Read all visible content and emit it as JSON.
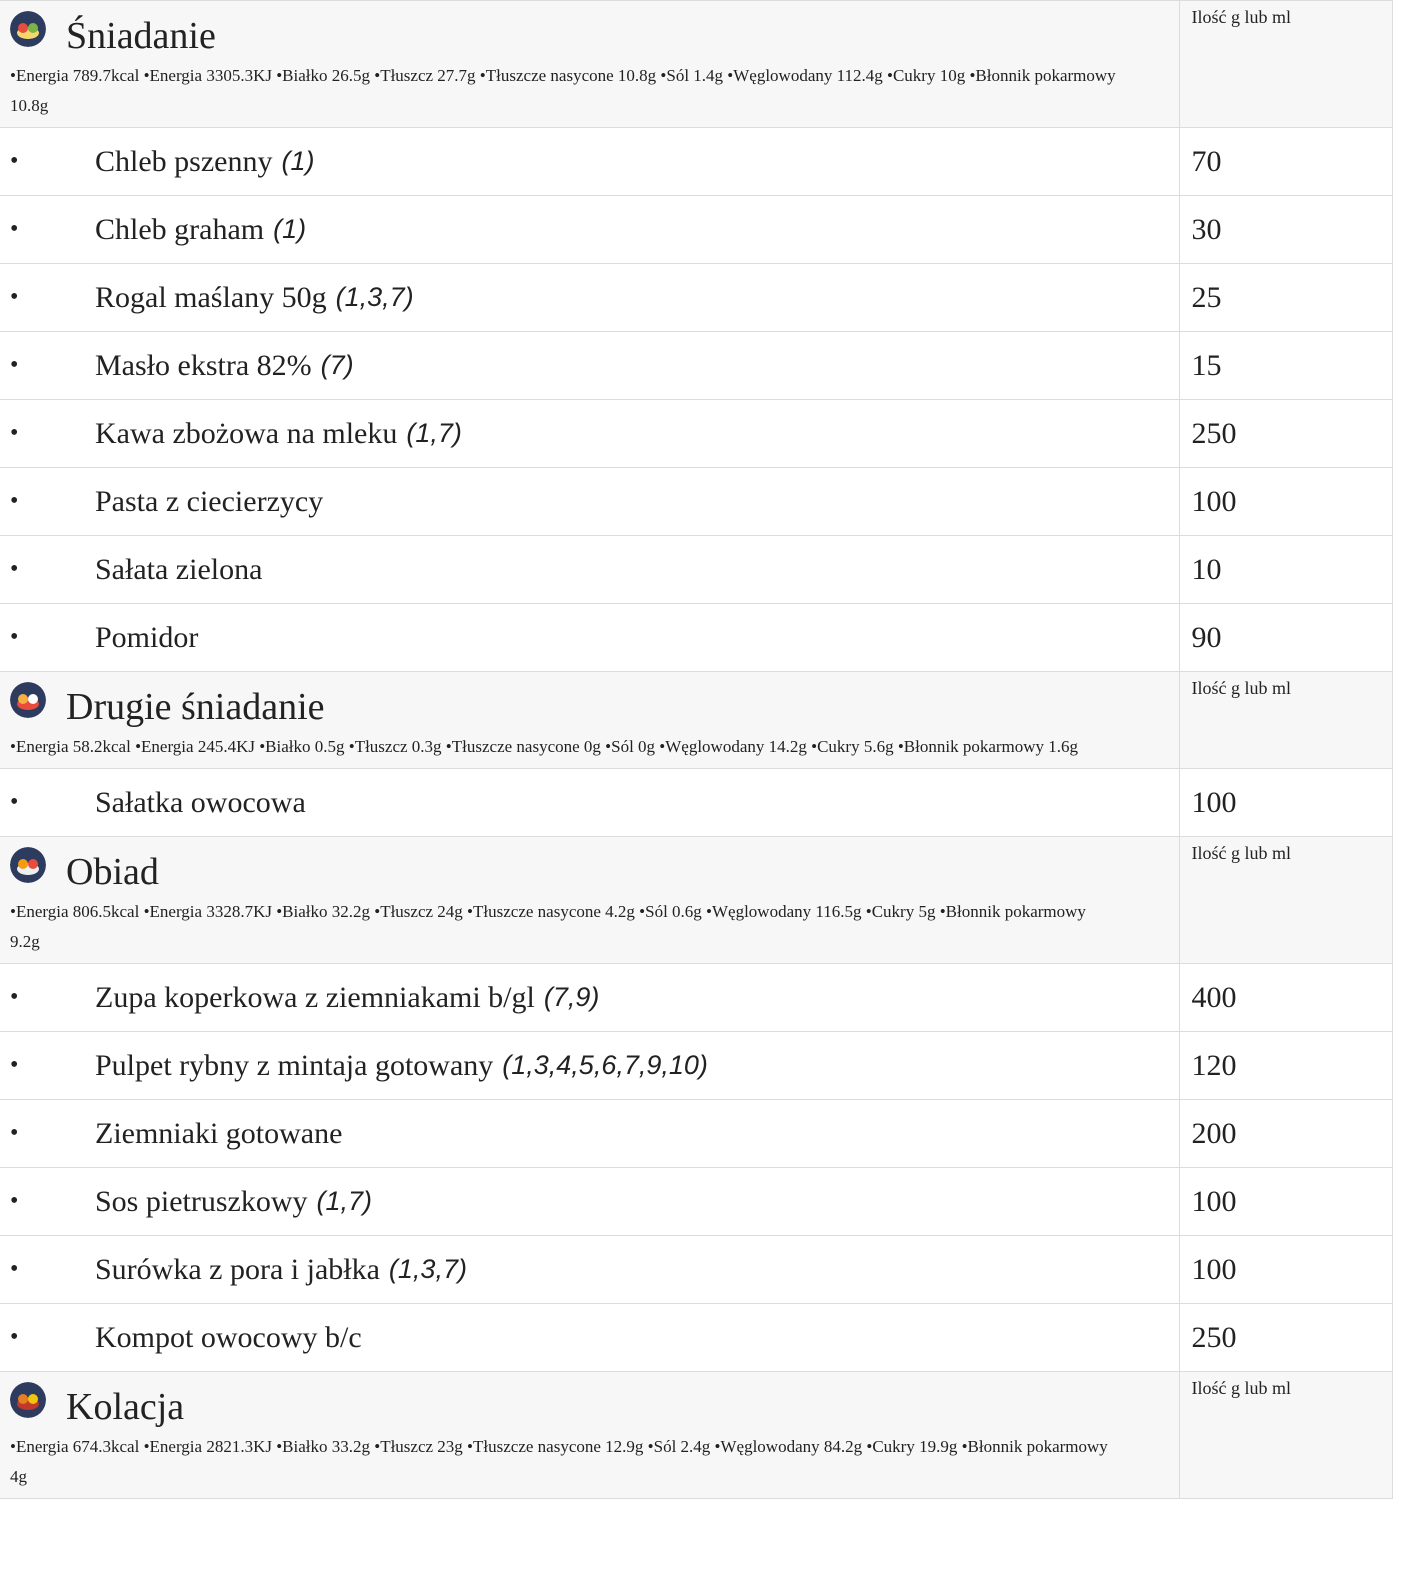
{
  "quantity_header": "Ilość g lub ml",
  "bullet": "•",
  "meals": [
    {
      "title": "Śniadanie",
      "icon": "breakfast-icon",
      "icon_colors": [
        "#2d3b5e",
        "#e74c3c",
        "#7cb342",
        "#f5d76e"
      ],
      "nutrition": "•Energia 789.7kcal •Energia 3305.3KJ •Białko 26.5g •Tłuszcz 27.7g •Tłuszcze nasycone 10.8g •Sól 1.4g •Węglowodany 112.4g •Cukry 10g •Błonnik pokarmowy 10.8g",
      "items": [
        {
          "name": "Chleb pszenny",
          "allergens": "(1)",
          "qty": "70"
        },
        {
          "name": "Chleb graham",
          "allergens": "(1)",
          "qty": "30"
        },
        {
          "name": "Rogal maślany 50g",
          "allergens": "(1,3,7)",
          "qty": "25"
        },
        {
          "name": "Masło ekstra 82%",
          "allergens": "(7)",
          "qty": "15"
        },
        {
          "name": "Kawa zbożowa na mleku",
          "allergens": "(1,7)",
          "qty": "250"
        },
        {
          "name": "Pasta z ciecierzycy",
          "allergens": "",
          "qty": "100"
        },
        {
          "name": "Sałata zielona",
          "allergens": "",
          "qty": "10"
        },
        {
          "name": "Pomidor",
          "allergens": "",
          "qty": "90"
        }
      ]
    },
    {
      "title": "Drugie śniadanie",
      "icon": "second-breakfast-icon",
      "icon_colors": [
        "#2d3b5e",
        "#f5b041",
        "#ffffff",
        "#e74c3c"
      ],
      "nutrition": "•Energia 58.2kcal •Energia 245.4KJ •Białko 0.5g •Tłuszcz 0.3g •Tłuszcze nasycone 0g •Sól 0g •Węglowodany 14.2g •Cukry 5.6g •Błonnik pokarmowy 1.6g",
      "items": [
        {
          "name": "Sałatka owocowa",
          "allergens": "",
          "qty": "100"
        }
      ]
    },
    {
      "title": "Obiad",
      "icon": "lunch-icon",
      "icon_colors": [
        "#2d3b5e",
        "#f39c12",
        "#e74c3c",
        "#ecf0f1"
      ],
      "nutrition": "•Energia 806.5kcal •Energia 3328.7KJ •Białko 32.2g •Tłuszcz 24g •Tłuszcze nasycone 4.2g •Sól 0.6g •Węglowodany 116.5g •Cukry  5g •Błonnik pokarmowy 9.2g",
      "items": [
        {
          "name": "Zupa koperkowa z ziemniakami b/gl",
          "allergens": "(7,9)",
          "qty": "400"
        },
        {
          "name": "Pulpet rybny z mintaja gotowany",
          "allergens": "(1,3,4,5,6,7,9,10)",
          "qty": "120"
        },
        {
          "name": "Ziemniaki gotowane",
          "allergens": "",
          "qty": "200"
        },
        {
          "name": "Sos pietruszkowy",
          "allergens": "(1,7)",
          "qty": "100"
        },
        {
          "name": "Surówka z pora i jabłka",
          "allergens": "(1,3,7)",
          "qty": "100"
        },
        {
          "name": "Kompot owocowy b/c",
          "allergens": "",
          "qty": "250"
        }
      ]
    },
    {
      "title": "Kolacja",
      "icon": "dinner-icon",
      "icon_colors": [
        "#2d3b5e",
        "#e67e22",
        "#f1c40f",
        "#c0392b"
      ],
      "nutrition": "•Energia 674.3kcal •Energia 2821.3KJ •Białko 33.2g •Tłuszcz 23g •Tłuszcze nasycone 12.9g •Sól 2.4g •Węglowodany 84.2g •Cukry 19.9g •Błonnik pokarmowy 4g",
      "items": []
    }
  ]
}
